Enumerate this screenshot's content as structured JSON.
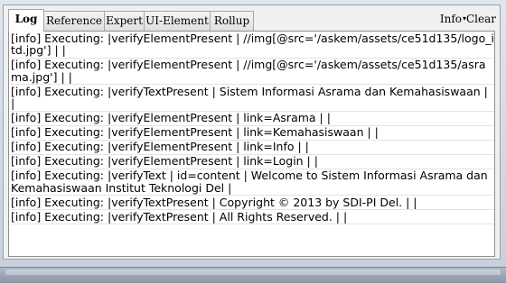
{
  "tabs": [
    {
      "label": "Log",
      "active": true
    },
    {
      "label": "Reference",
      "active": false
    },
    {
      "label": "Expert",
      "active": false
    },
    {
      "label": "UI-Element",
      "active": false
    },
    {
      "label": "Rollup",
      "active": false
    }
  ],
  "toolbar": {
    "info_label": "Info",
    "info_caret": "▾",
    "clear_label": "Clear"
  },
  "log": [
    "[info] Executing: |verifyElementPresent | //img[@src='/askem/assets/ce51d135/logo_itd.jpg'] | |",
    "[info] Executing: |verifyElementPresent | //img[@src='/askem/assets/ce51d135/asrama.jpg'] | |",
    "[info] Executing: |verifyTextPresent | Sistem Informasi Asrama dan Kemahasiswaan | |",
    "[info] Executing: |verifyElementPresent | link=Asrama | |",
    "[info] Executing: |verifyElementPresent | link=Kemahasiswaan | |",
    "[info] Executing: |verifyElementPresent | link=Info | |",
    "[info] Executing: |verifyElementPresent | link=Login | |",
    "[info] Executing: |verifyText | id=content | Welcome to Sistem Informasi Asrama dan Kemahasiswaan Institut Teknologi Del |",
    "[info] Executing: |verifyTextPresent | Copyright © 2013 by SDI-PI Del. | |",
    "[info] Executing: |verifyTextPresent | All Rights Reserved. | |"
  ],
  "colors": {
    "panel_bg": "#f0f0f0",
    "log_bg": "#ffffff",
    "frame_bg": "#c6cfdb"
  }
}
